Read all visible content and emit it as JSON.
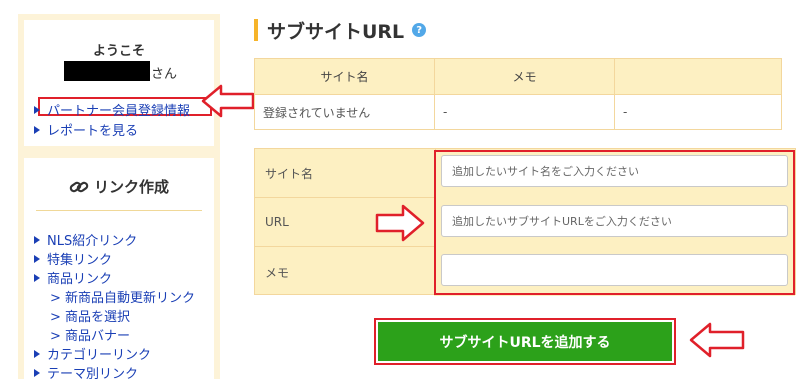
{
  "sidebar": {
    "welcome": "ようこそ",
    "user_suffix": "さん",
    "partner_link": "パートナー会員登録情報",
    "report_link": "レポートを見る",
    "link_section_title": "リンク作成",
    "link_items": [
      "NLS紹介リンク",
      "特集リンク",
      "商品リンク",
      "> 新商品自動更新リンク",
      "> 商品を選択",
      "> 商品バナー",
      "カテゴリーリンク",
      "テーマ別リンク"
    ]
  },
  "main": {
    "title": "サブサイトURL",
    "help_icon": "?",
    "table": {
      "headers": [
        "サイト名",
        "メモ",
        ""
      ],
      "rows": [
        [
          "登録されていません",
          "-",
          "-"
        ]
      ]
    },
    "form": {
      "site_name_label": "サイト名",
      "site_name_placeholder": "追加したいサイト名をご入力ください",
      "url_label": "URL",
      "url_placeholder": "追加したいサブサイトURLをご入力ください",
      "memo_label": "メモ",
      "memo_value": ""
    },
    "submit_label": "サブサイトURLを追加する"
  },
  "colors": {
    "accent_bar": "#f6b42a",
    "highlight_red": "#e0202a",
    "submit_green": "#2ca11a",
    "link_blue": "#1a3fb5",
    "table_header_bg": "#fdf0c2",
    "sidebar_bg": "#fdf3d8"
  }
}
